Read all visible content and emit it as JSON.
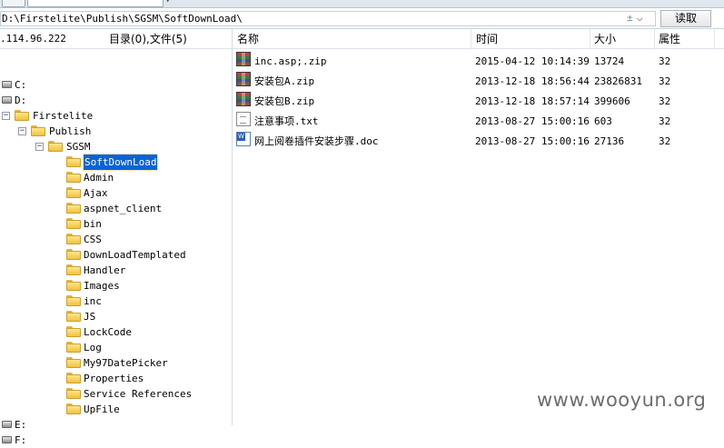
{
  "address": {
    "path": "D:\\Firstelite\\Publish\\SGSM\\SoftDownLoad\\",
    "read_button": "读取",
    "clear_icon": "±",
    "dropdown_icon": "chevron-down-icon"
  },
  "left_panel": {
    "ip": ".114.96.222",
    "counts": "目录(0),文件(5)"
  },
  "tree": [
    {
      "label": "C:",
      "type": "drive",
      "depth": 0
    },
    {
      "label": "D:",
      "type": "drive",
      "depth": 0
    },
    {
      "label": "Firstelite",
      "type": "folder",
      "depth": 0,
      "expander": "−"
    },
    {
      "label": "Publish",
      "type": "folder",
      "depth": 1,
      "expander": "−"
    },
    {
      "label": "SGSM",
      "type": "folder",
      "depth": 2,
      "expander": "−"
    },
    {
      "label": "SoftDownLoad",
      "type": "folder",
      "depth": 3,
      "selected": true
    },
    {
      "label": "Admin",
      "type": "folder",
      "depth": 3
    },
    {
      "label": "Ajax",
      "type": "folder",
      "depth": 3
    },
    {
      "label": "aspnet_client",
      "type": "folder",
      "depth": 3
    },
    {
      "label": "bin",
      "type": "folder",
      "depth": 3
    },
    {
      "label": "CSS",
      "type": "folder",
      "depth": 3
    },
    {
      "label": "DownLoadTemplated",
      "type": "folder",
      "depth": 3
    },
    {
      "label": "Handler",
      "type": "folder",
      "depth": 3
    },
    {
      "label": "Images",
      "type": "folder",
      "depth": 3
    },
    {
      "label": "inc",
      "type": "folder",
      "depth": 3
    },
    {
      "label": "JS",
      "type": "folder",
      "depth": 3
    },
    {
      "label": "LockCode",
      "type": "folder",
      "depth": 3
    },
    {
      "label": "Log",
      "type": "folder",
      "depth": 3
    },
    {
      "label": "My97DatePicker",
      "type": "folder",
      "depth": 3
    },
    {
      "label": "Properties",
      "type": "folder",
      "depth": 3
    },
    {
      "label": "Service References",
      "type": "folder",
      "depth": 3
    },
    {
      "label": "UpFile",
      "type": "folder",
      "depth": 3
    },
    {
      "label": "E:",
      "type": "drive",
      "depth": 0
    },
    {
      "label": "F:",
      "type": "drive",
      "depth": 0
    }
  ],
  "columns": {
    "name": "名称",
    "time": "时间",
    "size": "大小",
    "attr": "属性"
  },
  "files": [
    {
      "name": "inc.asp;.zip",
      "time": "2015-04-12 10:14:39",
      "size": "13724",
      "attr": "32",
      "icon": "zip"
    },
    {
      "name": "安装包A.zip",
      "time": "2013-12-18 18:56:44",
      "size": "23826831",
      "attr": "32",
      "icon": "zip"
    },
    {
      "name": "安装包B.zip",
      "time": "2013-12-18 18:57:14",
      "size": "399606",
      "attr": "32",
      "icon": "zip"
    },
    {
      "name": "注意事项.txt",
      "time": "2013-08-27 15:00:16",
      "size": "603",
      "attr": "32",
      "icon": "txt"
    },
    {
      "name": "网上阅卷插件安装步骤.doc",
      "time": "2013-08-27 15:00:16",
      "size": "27136",
      "attr": "32",
      "icon": "doc"
    }
  ],
  "watermark": "www.wooyun.org"
}
